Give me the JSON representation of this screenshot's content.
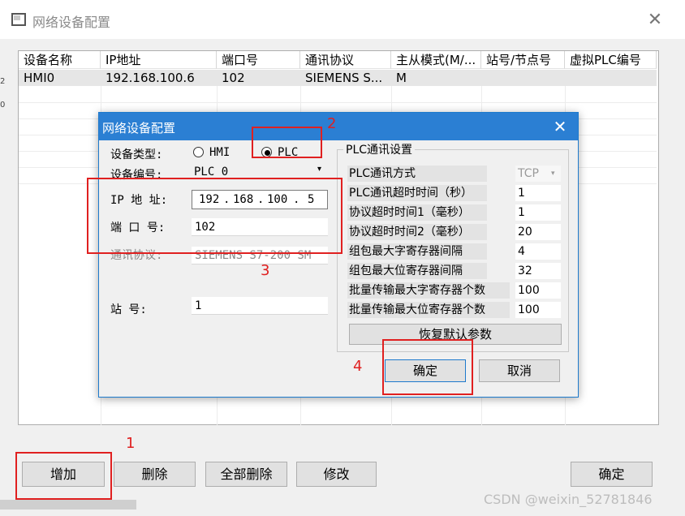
{
  "window": {
    "title": "网络设备配置",
    "close_glyph": "✕"
  },
  "device_table": {
    "columns": [
      "设备名称",
      "IP地址",
      "端口号",
      "通讯协议",
      "主从模式(M/...",
      "站号/节点号",
      "虚拟PLC编号"
    ],
    "rows": [
      [
        "HMI0",
        "192.168.100.6",
        "102",
        "SIEMENS S...",
        "M",
        "",
        ""
      ]
    ]
  },
  "edge_marks": [
    "2",
    "0"
  ],
  "bottom_buttons": {
    "add": "增加",
    "delete": "删除",
    "delete_all": "全部删除",
    "modify": "修改",
    "ok": "确定"
  },
  "dialog": {
    "title": "网络设备配置",
    "close_glyph": "✕",
    "device_type": {
      "label": "设备类型:",
      "option_hmi": "HMI",
      "option_plc": "PLC",
      "selected": "PLC"
    },
    "device_id": {
      "label": "设备编号:",
      "value": "PLC 0"
    },
    "ip": {
      "label": "IP 地 址:",
      "oct1": "192",
      "oct2": "168",
      "oct3": "100",
      "oct4": "5"
    },
    "port": {
      "label": "端 口 号:",
      "value": "102"
    },
    "protocol": {
      "label": "通讯协议:",
      "value": "SIEMENS S7-200 SM"
    },
    "station": {
      "label": "站  号:",
      "value": "1"
    },
    "plc_settings": {
      "title": "PLC通讯设置",
      "params": [
        {
          "label": "PLC通讯方式",
          "value": "TCP",
          "disabled": true
        },
        {
          "label": "PLC通讯超时时间（秒）",
          "value": "1"
        },
        {
          "label": "协议超时时间1（毫秒）",
          "value": "1"
        },
        {
          "label": "协议超时时间2（毫秒）",
          "value": "20"
        },
        {
          "label": "组包最大字寄存器间隔",
          "value": "4"
        },
        {
          "label": "组包最大位寄存器间隔",
          "value": "32"
        },
        {
          "label": "批量传输最大字寄存器个数",
          "value": "100"
        },
        {
          "label": "批量传输最大位寄存器个数",
          "value": "100"
        }
      ],
      "restore_button": "恢复默认参数"
    },
    "ok_button": "确定",
    "cancel_button": "取消"
  },
  "annotations": [
    "1",
    "2",
    "3",
    "4"
  ],
  "annotation_color": "#e02020",
  "watermark": "CSDN @weixin_52781846"
}
